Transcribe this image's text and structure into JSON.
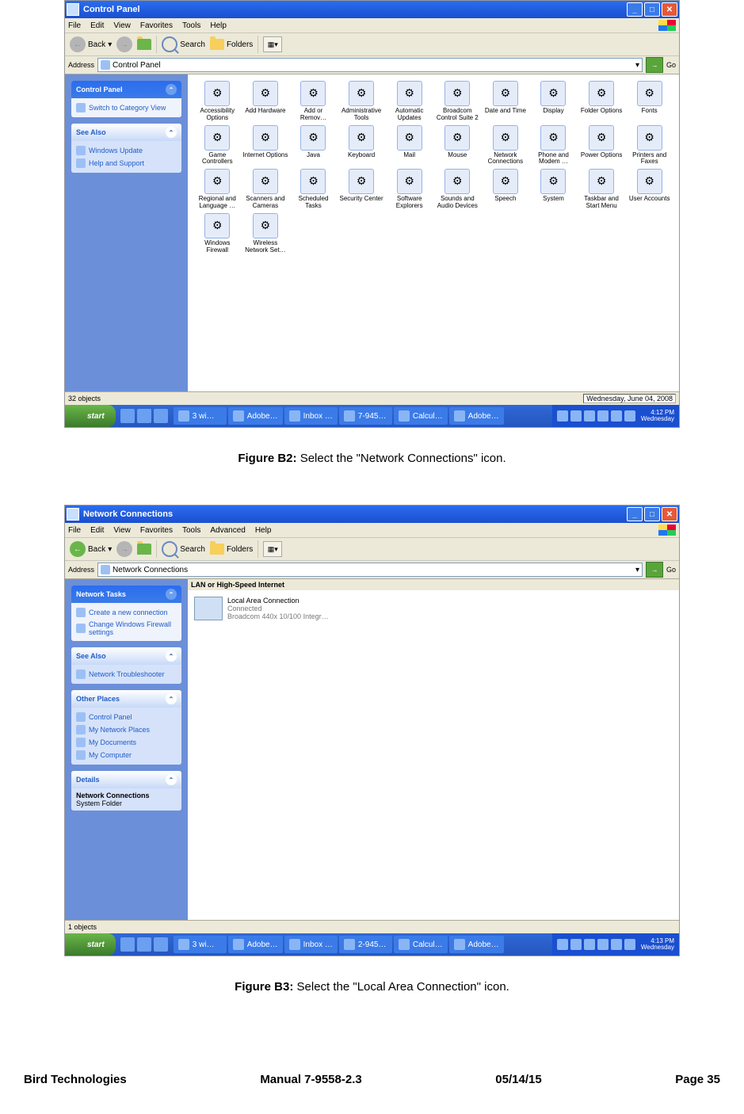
{
  "shot1": {
    "title": "Control Panel",
    "menus": [
      "File",
      "Edit",
      "View",
      "Favorites",
      "Tools",
      "Help"
    ],
    "toolbar": {
      "back": "Back",
      "search": "Search",
      "folders": "Folders"
    },
    "address_label": "Address",
    "address_value": "Control Panel",
    "go": "Go",
    "side_cp": {
      "title": "Control Panel",
      "link": "Switch to Category View"
    },
    "side_see": {
      "title": "See Also",
      "links": [
        "Windows Update",
        "Help and Support"
      ]
    },
    "icons": [
      "Accessibility Options",
      "Add Hardware",
      "Add or Remov…",
      "Administrative Tools",
      "Automatic Updates",
      "Broadcom Control Suite 2",
      "Date and Time",
      "Display",
      "Folder Options",
      "Fonts",
      "Game Controllers",
      "Internet Options",
      "Java",
      "Keyboard",
      "Mail",
      "Mouse",
      "Network Connections",
      "Phone and Modem …",
      "Power Options",
      "Printers and Faxes",
      "Regional and Language …",
      "Scanners and Cameras",
      "Scheduled Tasks",
      "Security Center",
      "Software Explorers",
      "Sounds and Audio Devices",
      "Speech",
      "System",
      "Taskbar and Start Menu",
      "User Accounts",
      "Windows Firewall",
      "Wireless Network Set…"
    ],
    "status_left": "32 objects",
    "status_right": "Wednesday, June 04, 2008",
    "task": {
      "start": "start",
      "tasks": [
        "3 wi…",
        "Adobe…",
        "Inbox …",
        "7-945…",
        "Calcul…",
        "Adobe…"
      ],
      "clock_time": "4:12 PM",
      "clock_day": "Wednesday"
    }
  },
  "caption1_b": "Figure B2:",
  "caption1_t": " Select the \"Network Connections\" icon.",
  "shot2": {
    "title": "Network Connections",
    "menus": [
      "File",
      "Edit",
      "View",
      "Favorites",
      "Tools",
      "Advanced",
      "Help"
    ],
    "toolbar": {
      "back": "Back",
      "search": "Search",
      "folders": "Folders"
    },
    "address_label": "Address",
    "address_value": "Network Connections",
    "go": "Go",
    "section": "LAN or High-Speed Internet",
    "conn": {
      "name": "Local Area Connection",
      "status": "Connected",
      "adapter": "Broadcom 440x 10/100 Integr…"
    },
    "p_tasks": {
      "title": "Network Tasks",
      "links": [
        "Create a new connection",
        "Change Windows Firewall settings"
      ]
    },
    "p_see": {
      "title": "See Also",
      "links": [
        "Network Troubleshooter"
      ]
    },
    "p_places": {
      "title": "Other Places",
      "links": [
        "Control Panel",
        "My Network Places",
        "My Documents",
        "My Computer"
      ]
    },
    "p_details": {
      "title": "Details",
      "name": "Network Connections",
      "type": "System Folder"
    },
    "status_left": "1 objects",
    "task": {
      "start": "start",
      "tasks": [
        "3 wi…",
        "Adobe…",
        "Inbox …",
        "2-945…",
        "Calcul…",
        "Adobe…"
      ],
      "clock_time": "4:13 PM",
      "clock_day": "Wednesday"
    }
  },
  "caption2_b": "Figure B3:",
  "caption2_t": " Select the \"Local Area Connection\" icon.",
  "footer": {
    "left": "Bird Technologies",
    "mid": "Manual 7-9558-2.3",
    "date": "05/14/15",
    "page": "Page 35"
  }
}
